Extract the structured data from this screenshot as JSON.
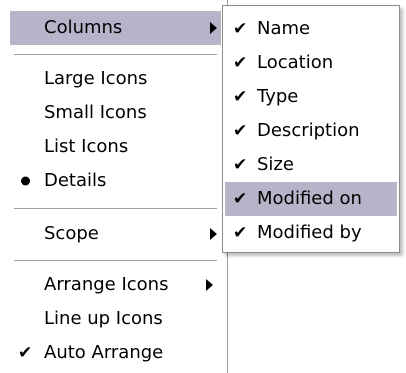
{
  "main_menu": {
    "columns": "Columns",
    "large_icons": "Large Icons",
    "small_icons": "Small Icons",
    "list_icons": "List Icons",
    "details": "Details",
    "scope": "Scope",
    "arrange_icons": "Arrange Icons",
    "line_up_icons": "Line up Icons",
    "auto_arrange": "Auto Arrange"
  },
  "columns_submenu": {
    "name": "Name",
    "location": "Location",
    "type": "Type",
    "description": "Description",
    "size": "Size",
    "modified_on": "Modified on",
    "modified_by": "Modified by"
  },
  "glyphs": {
    "check": "✔"
  },
  "colors": {
    "highlight": "#b6b4c8"
  }
}
